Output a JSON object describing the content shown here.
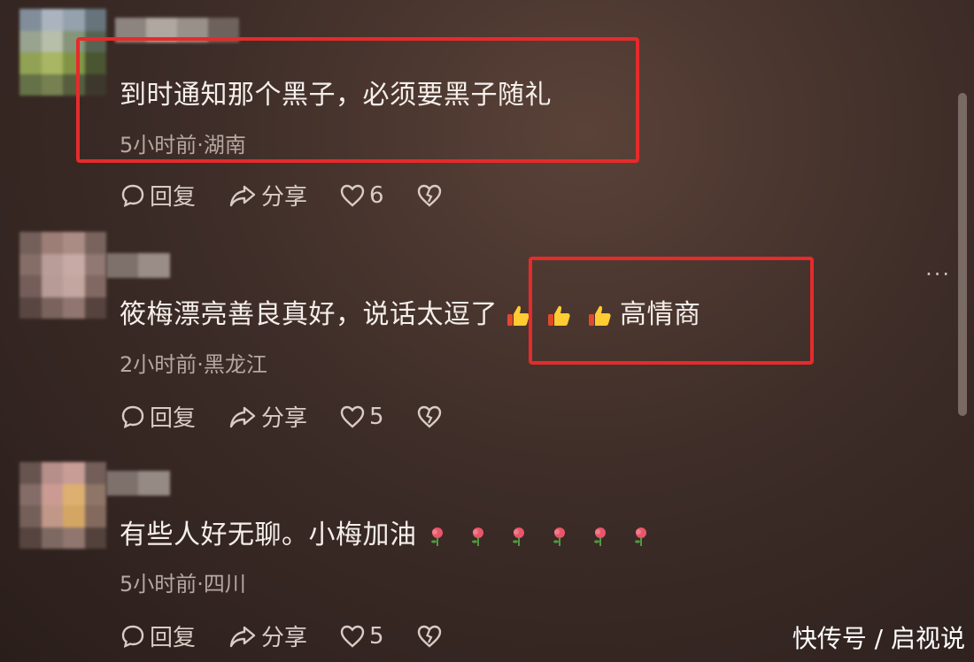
{
  "comments": [
    {
      "text": "到时通知那个黑子，必须要黑子随礼",
      "meta": "5小时前·湖南",
      "reply_label": "回复",
      "share_label": "分享",
      "likes": "6"
    },
    {
      "text": "筱梅漂亮善良真好，说话太逗了",
      "text_suffix": "高情商",
      "meta": "2小时前·黑龙江",
      "reply_label": "回复",
      "share_label": "分享",
      "likes": "5"
    },
    {
      "text": "有些人好无聊。小梅加油",
      "meta": "5小时前·四川",
      "reply_label": "回复",
      "share_label": "分享",
      "likes": "5"
    }
  ],
  "more_label": "···",
  "watermark": "快传号 / 启视说",
  "colors": {
    "highlight_box": "#e52b2b",
    "background": "#3e2d28"
  },
  "icons": [
    "comment-icon",
    "share-arrow-icon",
    "heart-icon",
    "broken-heart-icon",
    "thumbs-up-emoji",
    "flower-emoji",
    "more-icon"
  ]
}
